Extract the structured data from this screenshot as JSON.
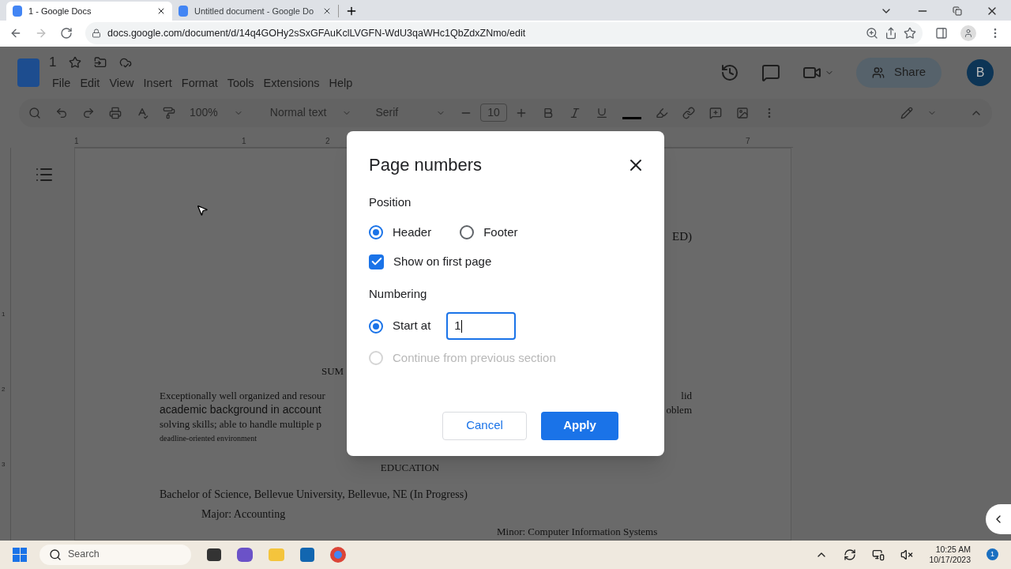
{
  "browser": {
    "tabs": [
      {
        "title": "1 - Google Docs",
        "selected": true
      },
      {
        "title": "Untitled document - Google Do",
        "selected": false
      }
    ],
    "url": "docs.google.com/document/d/14q4GOHy2sSxGFAuKclLVGFN-WdU3qaWHc1QbZdxZNmo/edit"
  },
  "docs": {
    "title": "1",
    "menu": [
      "File",
      "Edit",
      "View",
      "Insert",
      "Format",
      "Tools",
      "Extensions",
      "Help"
    ],
    "share": "Share",
    "avatar": "B",
    "toolbar": {
      "zoom": "100%",
      "style": "Normal text",
      "font": "Serif",
      "font_size": "10"
    },
    "ruler": [
      "1",
      "1",
      "2",
      "7"
    ],
    "vertical_ruler": [
      "1",
      "2",
      "3"
    ]
  },
  "document": {
    "right_fragment": "ED)",
    "heading": "SUM",
    "paragraph": [
      {
        "left": "Exceptionally well organized and resour",
        "right": "lid",
        "kind": "serif"
      },
      {
        "left": "academic background in account",
        "right": "oblem",
        "kind": "sans"
      },
      {
        "left": "solving skills; able to handle multiple p",
        "kind": "serif"
      },
      {
        "left": "deadline-oriented environment",
        "kind": "small"
      }
    ],
    "education_heading": "EDUCATION",
    "degree": "Bachelor of Science, Bellevue University, Bellevue, NE (In Progress)",
    "major": "Major: Accounting",
    "minor": "Minor: Computer Information Systems"
  },
  "dialog": {
    "title": "Page numbers",
    "position_label": "Position",
    "position_options": [
      {
        "label": "Header",
        "selected": true
      },
      {
        "label": "Footer",
        "selected": false
      }
    ],
    "first_page": {
      "label": "Show on first page",
      "checked": true
    },
    "numbering_label": "Numbering",
    "numbering_options": [
      {
        "label": "Start at",
        "selected": true,
        "disabled": false,
        "value": "1"
      },
      {
        "label": "Continue from previous section",
        "selected": false,
        "disabled": true
      }
    ],
    "cancel": "Cancel",
    "apply": "Apply"
  },
  "taskbar": {
    "search_placeholder": "Search",
    "time": "10:25 AM",
    "date": "10/17/2023",
    "notifications": "1"
  }
}
